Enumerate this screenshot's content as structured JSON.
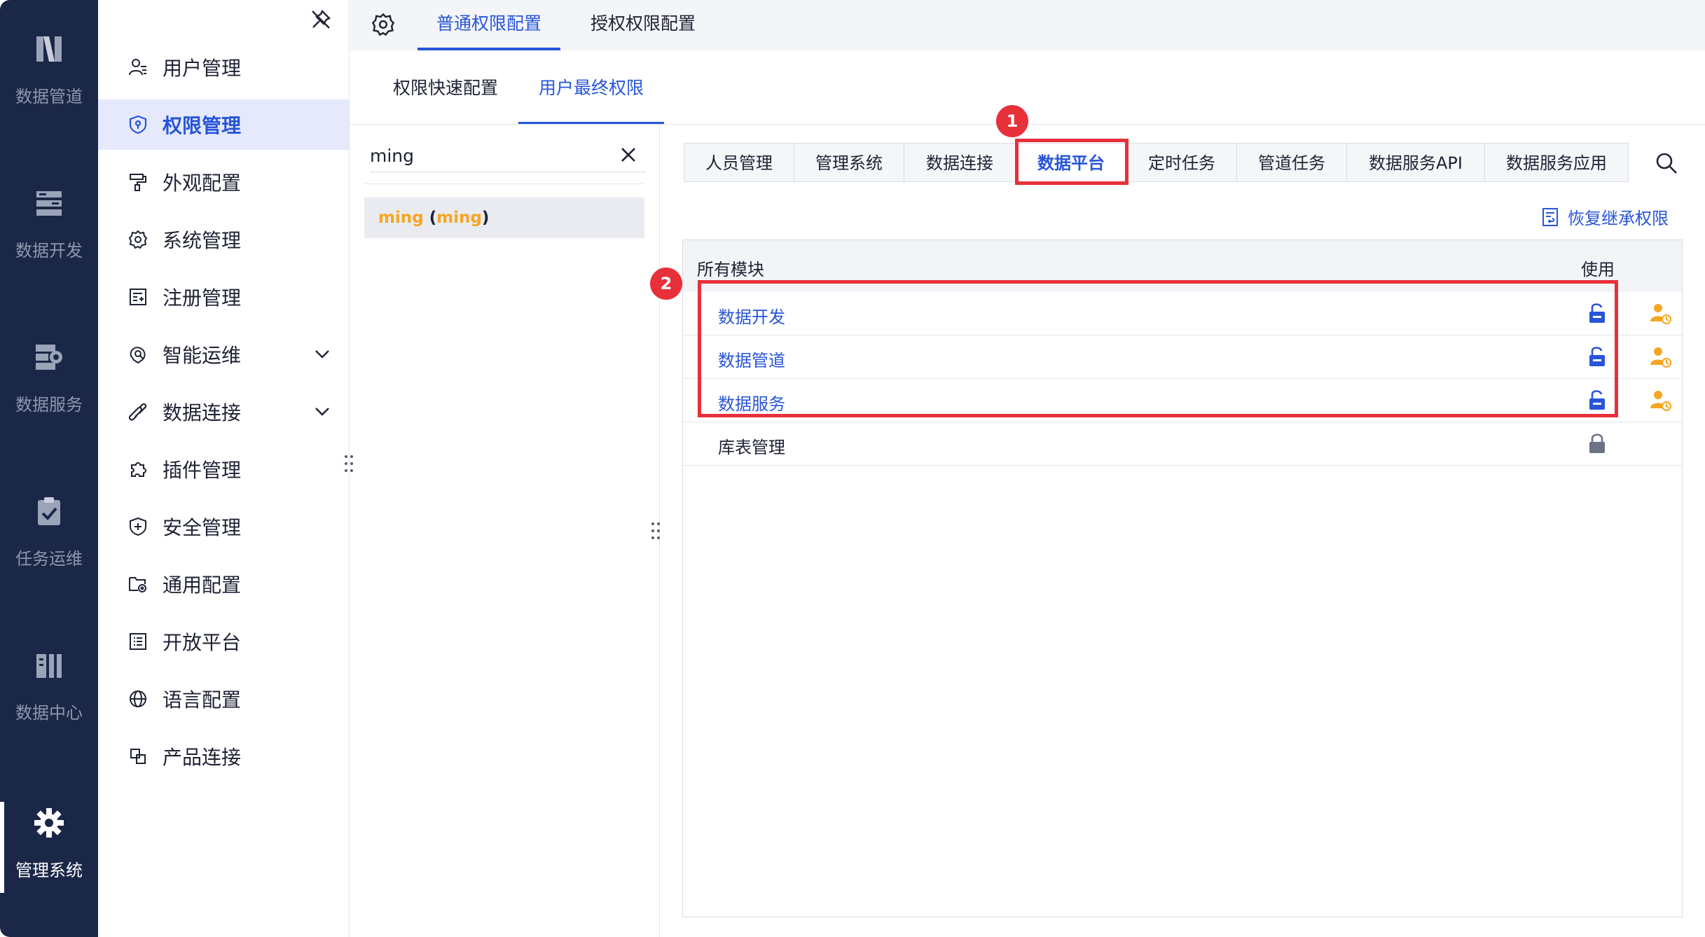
{
  "rail": {
    "items": [
      {
        "label": "数据管道",
        "icon": "data-pipeline-icon"
      },
      {
        "label": "数据开发",
        "icon": "data-dev-icon"
      },
      {
        "label": "数据服务",
        "icon": "data-service-icon"
      },
      {
        "label": "任务运维",
        "icon": "task-ops-icon"
      },
      {
        "label": "数据中心",
        "icon": "data-center-icon"
      },
      {
        "label": "管理系统",
        "icon": "gear-icon"
      }
    ],
    "active": "管理系统"
  },
  "sidebar": {
    "items": [
      {
        "label": "用户管理",
        "icon": "user-icon"
      },
      {
        "label": "权限管理",
        "icon": "shield-icon"
      },
      {
        "label": "外观配置",
        "icon": "paint-roller-icon"
      },
      {
        "label": "系统管理",
        "icon": "gear-icon"
      },
      {
        "label": "注册管理",
        "icon": "register-icon"
      },
      {
        "label": "智能运维",
        "icon": "monitor-icon"
      },
      {
        "label": "数据连接",
        "icon": "link-icon"
      },
      {
        "label": "插件管理",
        "icon": "puzzle-icon"
      },
      {
        "label": "安全管理",
        "icon": "shield-plus-icon"
      },
      {
        "label": "通用配置",
        "icon": "folder-gear-icon"
      },
      {
        "label": "开放平台",
        "icon": "list-icon"
      },
      {
        "label": "语言配置",
        "icon": "globe-icon"
      },
      {
        "label": "产品连接",
        "icon": "product-link-icon"
      }
    ],
    "active": "权限管理"
  },
  "top_tabs": [
    "普通权限配置",
    "授权权限配置"
  ],
  "sub_tabs": [
    "权限快速配置",
    "用户最终权限"
  ],
  "search": {
    "value": "ming"
  },
  "user": {
    "name": "ming",
    "open": " (",
    "id": "ming",
    "close": ")"
  },
  "category_tabs": [
    "人员管理",
    "管理系统",
    "数据连接",
    "数据平台",
    "定时任务",
    "管道任务",
    "数据服务API",
    "数据服务应用"
  ],
  "active_category": "数据平台",
  "restore_label": "恢复继承权限",
  "table": {
    "headers": {
      "name": "所有模块",
      "use": "使用"
    },
    "rows": [
      {
        "name": "数据开发",
        "link": true
      },
      {
        "name": "数据管道",
        "link": true
      },
      {
        "name": "数据服务",
        "link": true
      },
      {
        "name": "库表管理",
        "link": false
      }
    ]
  },
  "annotations": {
    "badge1": "1",
    "badge2": "2"
  },
  "colors": {
    "accent": "#2855d8",
    "rail_bg": "#1b2747",
    "highlight": "#e8303a",
    "user_orange": "#f5a623"
  }
}
